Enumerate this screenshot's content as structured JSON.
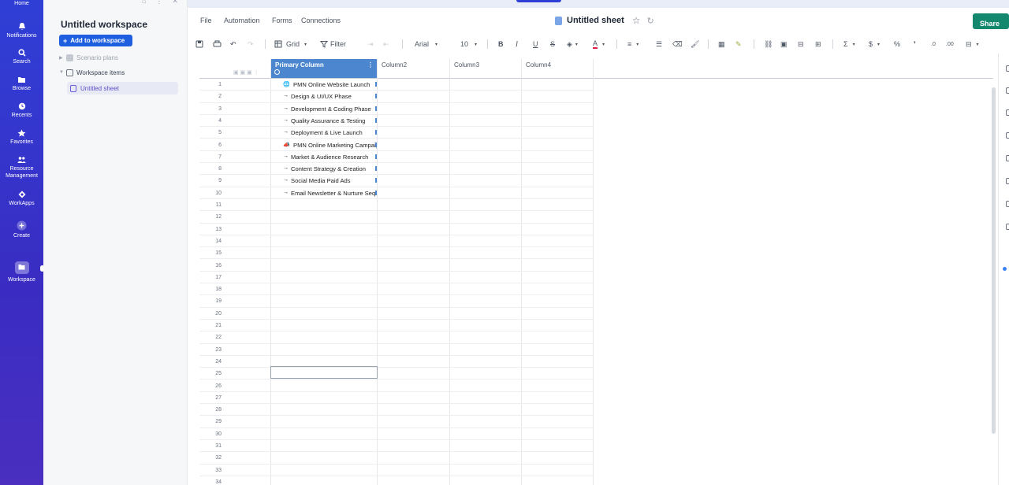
{
  "nav": {
    "items": [
      {
        "label": "Home",
        "icon": "home-icon"
      },
      {
        "label": "Notifications",
        "icon": "bell-icon"
      },
      {
        "label": "Search",
        "icon": "search-icon"
      },
      {
        "label": "Browse",
        "icon": "folder-icon"
      },
      {
        "label": "Recents",
        "icon": "clock-icon"
      },
      {
        "label": "Favorites",
        "icon": "star-icon"
      },
      {
        "label": "Resource Management",
        "icon": "people-icon"
      },
      {
        "label": "WorkApps",
        "icon": "workapps-icon"
      },
      {
        "label": "Create",
        "icon": "plus-icon"
      },
      {
        "label": "Workspace",
        "icon": "workspace-icon"
      }
    ]
  },
  "workspace": {
    "title": "Untitled workspace",
    "add_button": "Add to workspace",
    "tree": [
      {
        "label": "Scenario plans",
        "color": "#9ca3af"
      },
      {
        "label": "Workspace items",
        "color": "#374151"
      }
    ],
    "selected_item": "Untitled sheet"
  },
  "menu": {
    "file": "File",
    "automation": "Automation",
    "forms": "Forms",
    "connections": "Connections"
  },
  "sheet_title": "Untitled sheet",
  "share_label": "Share",
  "toolbar": {
    "view": "Grid",
    "filter": "Filter",
    "font": "Arial",
    "font_size": "10"
  },
  "columns": [
    "Primary Column",
    "Column2",
    "Column3",
    "Column4"
  ],
  "rows": [
    {
      "num": "1",
      "text": "PMN Online Website Launch",
      "marker": "🌐"
    },
    {
      "num": "2",
      "text": "Design & UI/UX Phase",
      "marker": "→"
    },
    {
      "num": "3",
      "text": "Development & Coding Phase",
      "marker": "→"
    },
    {
      "num": "4",
      "text": "Quality Assurance & Testing",
      "marker": "→"
    },
    {
      "num": "5",
      "text": "Deployment & Live Launch",
      "marker": "→"
    },
    {
      "num": "6",
      "text": "PMN Online Marketing Campaign",
      "marker": "📣"
    },
    {
      "num": "7",
      "text": "Market & Audience Research",
      "marker": "→"
    },
    {
      "num": "8",
      "text": "Content Strategy & Creation",
      "marker": "→"
    },
    {
      "num": "9",
      "text": "Social Media Paid Ads",
      "marker": "→"
    },
    {
      "num": "10",
      "text": "Email Newsletter & Nurture Sequence",
      "marker": "→"
    },
    {
      "num": "11",
      "text": "",
      "marker": ""
    },
    {
      "num": "12",
      "text": "",
      "marker": ""
    },
    {
      "num": "13",
      "text": "",
      "marker": ""
    },
    {
      "num": "14",
      "text": "",
      "marker": ""
    },
    {
      "num": "15",
      "text": "",
      "marker": ""
    },
    {
      "num": "16",
      "text": "",
      "marker": ""
    },
    {
      "num": "17",
      "text": "",
      "marker": ""
    },
    {
      "num": "18",
      "text": "",
      "marker": ""
    },
    {
      "num": "19",
      "text": "",
      "marker": ""
    },
    {
      "num": "20",
      "text": "",
      "marker": ""
    },
    {
      "num": "21",
      "text": "",
      "marker": ""
    },
    {
      "num": "22",
      "text": "",
      "marker": ""
    },
    {
      "num": "23",
      "text": "",
      "marker": ""
    },
    {
      "num": "24",
      "text": "",
      "marker": ""
    },
    {
      "num": "25",
      "text": "",
      "marker": ""
    },
    {
      "num": "26",
      "text": "",
      "marker": ""
    },
    {
      "num": "27",
      "text": "",
      "marker": ""
    },
    {
      "num": "28",
      "text": "",
      "marker": ""
    },
    {
      "num": "29",
      "text": "",
      "marker": ""
    },
    {
      "num": "30",
      "text": "",
      "marker": ""
    },
    {
      "num": "31",
      "text": "",
      "marker": ""
    },
    {
      "num": "32",
      "text": "",
      "marker": ""
    },
    {
      "num": "33",
      "text": "",
      "marker": ""
    },
    {
      "num": "34",
      "text": "",
      "marker": ""
    }
  ],
  "colors": {
    "nav": "#2f3fd6",
    "primary_header": "#4c86cf",
    "add_button": "#1e5fe0",
    "share": "#13886f"
  }
}
